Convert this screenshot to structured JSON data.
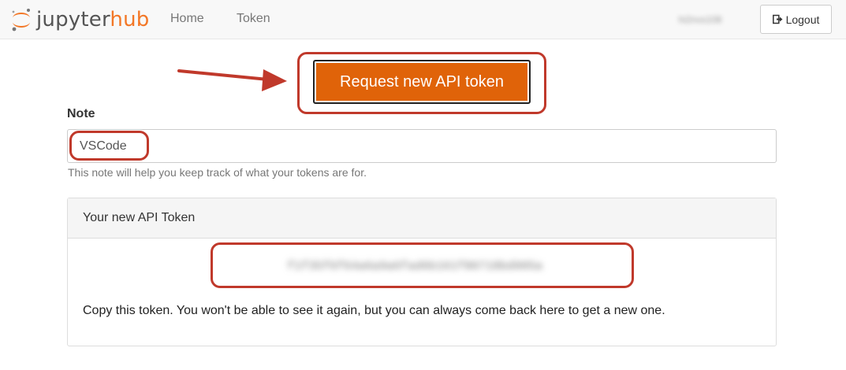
{
  "navbar": {
    "logo": {
      "word_left": "jupyter",
      "word_right": "hub"
    },
    "links": [
      {
        "label": "Home"
      },
      {
        "label": "Token"
      }
    ],
    "user_name": "hi2nvs108",
    "logout_label": "Logout"
  },
  "request_button_label": "Request new API token",
  "note": {
    "label": "Note",
    "value": "VSCode",
    "help": "This note will help you keep track of what your tokens are for."
  },
  "token_panel": {
    "heading": "Your new API Token",
    "token_value": "f1f35f6f64a6a9a6fad6b161f80718bd905a",
    "instructions": "Copy this token. You won't be able to see it again, but you can always come back here to get a new one."
  },
  "colors": {
    "accent": "#e06309",
    "annotation": "#c0392b",
    "brand_orange": "#f37726"
  }
}
